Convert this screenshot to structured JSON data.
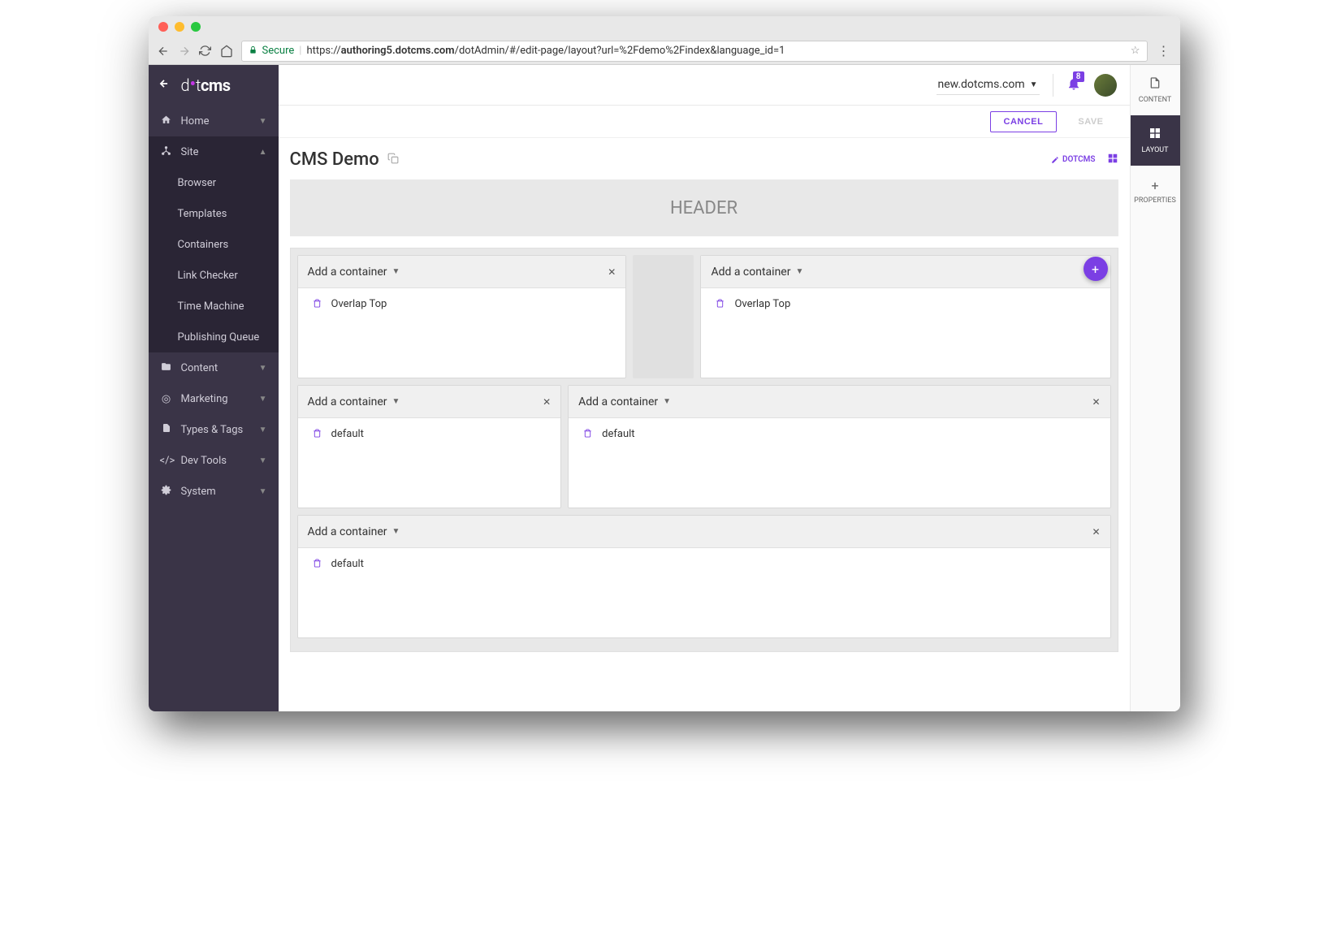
{
  "browser": {
    "secure_label": "Secure",
    "url_host": "authoring5.dotcms.com",
    "url_prefix": "https://",
    "url_path": "/dotAdmin/#/edit-page/layout?url=%2Fdemo%2Findex&language_id=1"
  },
  "logo": {
    "part1": "d",
    "part2": "t",
    "part3": "cms"
  },
  "sidebar": {
    "items": [
      {
        "label": "Home",
        "icon": "home"
      },
      {
        "label": "Site",
        "icon": "sitemap",
        "expanded": true
      },
      {
        "label": "Content",
        "icon": "folder"
      },
      {
        "label": "Marketing",
        "icon": "target"
      },
      {
        "label": "Types & Tags",
        "icon": "file"
      },
      {
        "label": "Dev Tools",
        "icon": "code"
      },
      {
        "label": "System",
        "icon": "gear"
      }
    ],
    "subitems": [
      {
        "label": "Browser"
      },
      {
        "label": "Templates"
      },
      {
        "label": "Containers"
      },
      {
        "label": "Link Checker"
      },
      {
        "label": "Time Machine"
      },
      {
        "label": "Publishing Queue"
      }
    ]
  },
  "topbar": {
    "domain": "new.dotcms.com",
    "notif_count": "8"
  },
  "actions": {
    "cancel": "CANCEL",
    "save": "SAVE"
  },
  "page": {
    "title": "CMS Demo",
    "theme": "DOTCMS",
    "header_label": "HEADER"
  },
  "containers": {
    "add_label": "Add a container",
    "row1_col1_item": "Overlap Top",
    "row1_col2_item": "Overlap Top",
    "row2_col1_item": "default",
    "row2_col2_item": "default",
    "row3_col1_item": "default"
  },
  "right_tabs": [
    {
      "label": "CONTENT",
      "icon": "doc"
    },
    {
      "label": "LAYOUT",
      "icon": "grid",
      "active": true
    },
    {
      "label": "PROPERTIES",
      "icon": "plus"
    }
  ]
}
